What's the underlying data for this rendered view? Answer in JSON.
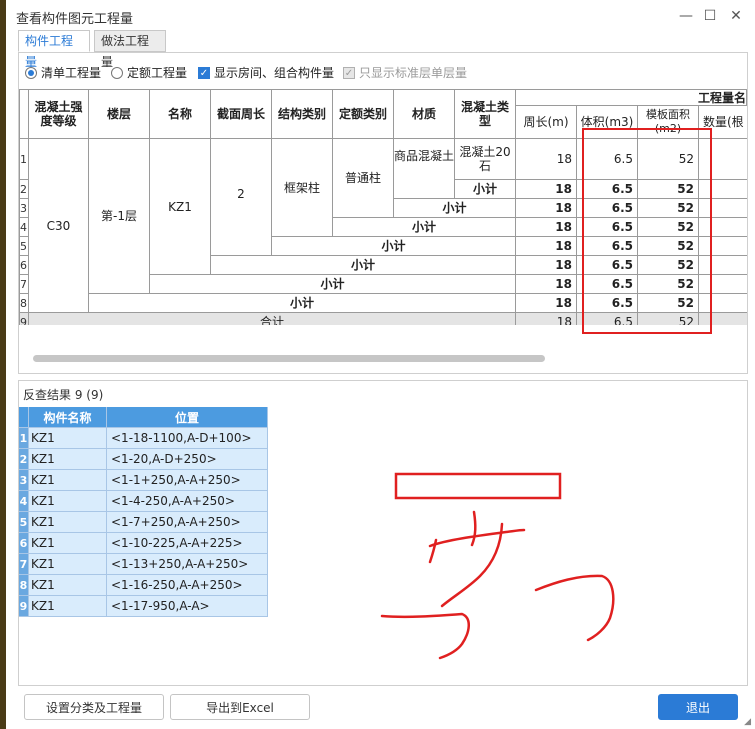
{
  "window": {
    "title": "查看构件图元工程量",
    "minimize_glyph": "—",
    "maximize_glyph": "☐",
    "close_glyph": "✕"
  },
  "tabs": [
    {
      "label": "构件工程量",
      "active": true
    },
    {
      "label": "做法工程量",
      "active": false
    }
  ],
  "options": {
    "radio_list": "清单工程量",
    "radio_quota": "定额工程量",
    "check_show_rooms": "显示房间、组合构件量",
    "check_std_floor": "只显示标准层单层量"
  },
  "table": {
    "group_header": "工程量名",
    "headers": [
      "混凝土强度等级",
      "楼层",
      "名称",
      "截面周长",
      "结构类别",
      "定额类别",
      "材质",
      "混凝土类型",
      "周长(m)",
      "体积(m3)",
      "模板面积(m2)",
      "数量(根"
    ],
    "strength": "C30",
    "floor": "第-1层",
    "name": "KZ1",
    "perimeter": "2",
    "struct_type": "框架柱",
    "quota_type": "普通柱",
    "material": "商品混凝土",
    "concrete_type": "混凝土20石",
    "subtotal": "小计",
    "total": "合计",
    "row_numbers": [
      "1",
      "2",
      "3",
      "4",
      "5",
      "6",
      "7",
      "8",
      "9"
    ],
    "rows": [
      {
        "perimeter": "18",
        "volume": "6.5",
        "formwork": "52"
      },
      {
        "perimeter": "18",
        "volume": "6.5",
        "formwork": "52"
      },
      {
        "perimeter": "18",
        "volume": "6.5",
        "formwork": "52"
      },
      {
        "perimeter": "18",
        "volume": "6.5",
        "formwork": "52"
      },
      {
        "perimeter": "18",
        "volume": "6.5",
        "formwork": "52"
      },
      {
        "perimeter": "18",
        "volume": "6.5",
        "formwork": "52"
      },
      {
        "perimeter": "18",
        "volume": "6.5",
        "formwork": "52"
      },
      {
        "perimeter": "18",
        "volume": "6.5",
        "formwork": "52"
      },
      {
        "perimeter": "18",
        "volume": "6.5",
        "formwork": "52"
      }
    ]
  },
  "reverse": {
    "title": "反查结果  9 (9)",
    "col_name": "构件名称",
    "col_position": "位置",
    "rows": [
      {
        "n": "1",
        "name": "KZ1",
        "pos": "<1-18-1100,A-D+100>"
      },
      {
        "n": "2",
        "name": "KZ1",
        "pos": "<1-20,A-D+250>"
      },
      {
        "n": "3",
        "name": "KZ1",
        "pos": "<1-1+250,A-A+250>"
      },
      {
        "n": "4",
        "name": "KZ1",
        "pos": "<1-4-250,A-A+250>"
      },
      {
        "n": "5",
        "name": "KZ1",
        "pos": "<1-7+250,A-A+250>"
      },
      {
        "n": "6",
        "name": "KZ1",
        "pos": "<1-10-225,A-A+225>"
      },
      {
        "n": "7",
        "name": "KZ1",
        "pos": "<1-13+250,A-A+250>"
      },
      {
        "n": "8",
        "name": "KZ1",
        "pos": "<1-16-250,A-A+250>"
      },
      {
        "n": "9",
        "name": "KZ1",
        "pos": "<1-17-950,A-A>"
      }
    ]
  },
  "buttons": {
    "set_category": "设置分类及工程量",
    "export_excel": "导出到Excel",
    "exit": "退出"
  },
  "colors": {
    "accent": "#2b7bd6",
    "annotation": "#e02020"
  }
}
